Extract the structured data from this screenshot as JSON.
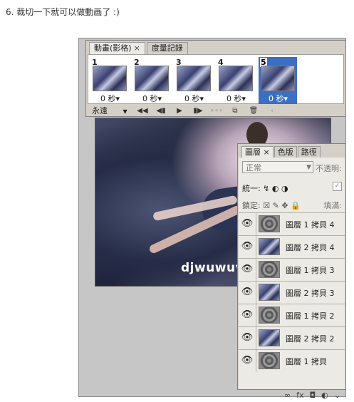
{
  "caption": "6. 裁切一下就可以做動画了 :)",
  "animation_panel": {
    "tabs": [
      {
        "label": "動畫(影格)",
        "close": "×"
      },
      {
        "label": "度量記錄"
      }
    ],
    "frames": [
      {
        "num": "1",
        "delay": "0 秒▾",
        "selected": false
      },
      {
        "num": "2",
        "delay": "0 秒▾",
        "selected": false
      },
      {
        "num": "3",
        "delay": "0 秒▾",
        "selected": false
      },
      {
        "num": "4",
        "delay": "0 秒▾",
        "selected": false
      },
      {
        "num": "5",
        "delay": "0 秒▾",
        "selected": true
      }
    ],
    "loop_label": "永遠",
    "loop_arrow": "▼",
    "controls": [
      "◀◀",
      "◀▮",
      "▶",
      "▮▶",
      "∘∘∘",
      "⧉",
      "🗑",
      "‹"
    ]
  },
  "canvas": {
    "watermark": "djwuwuv"
  },
  "layers_panel": {
    "tabs": [
      {
        "label": "圖層",
        "close": "×"
      },
      {
        "label": "色版"
      },
      {
        "label": "路徑"
      }
    ],
    "blend_mode": "正常",
    "opacity_label": "不透明:",
    "unify_label": "統一:",
    "unify_icons": "↯ ◐ ◑",
    "unify_check": "✓",
    "lock_label": "鎖定:",
    "lock_icons": "☒ ✎ ✥ 🔒",
    "fill_label": "填滿:",
    "layers": [
      {
        "name": "圖層 1 拷貝 4",
        "thumb": "rings"
      },
      {
        "name": "圖層 2 拷貝 4",
        "thumb": "photo"
      },
      {
        "name": "圖層 1 拷貝 3",
        "thumb": "rings"
      },
      {
        "name": "圖層 2 拷貝 3",
        "thumb": "photo"
      },
      {
        "name": "圖層 1 拷貝 2",
        "thumb": "rings"
      },
      {
        "name": "圖層 2 拷貝 2",
        "thumb": "photo"
      },
      {
        "name": "圖層 1 拷貝",
        "thumb": "rings"
      }
    ],
    "eye_icon": "👁",
    "footer_icons": [
      "∞",
      "fx",
      "◘",
      "◐",
      "⌄"
    ]
  }
}
